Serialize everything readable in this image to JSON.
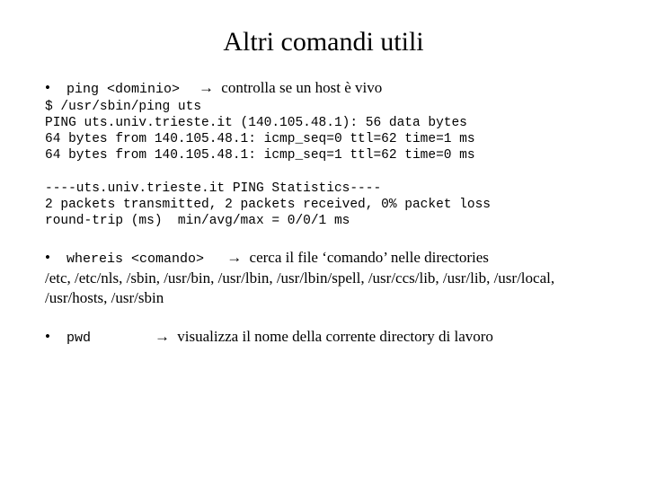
{
  "title": "Altri comandi utili",
  "items": [
    {
      "cmd": "ping <dominio>",
      "arrow": "→",
      "desc": "controlla se un host è vivo"
    },
    {
      "cmd": "whereis <comando>",
      "arrow": "→",
      "desc": "cerca il file ‘comando’ nelle directories"
    },
    {
      "cmd": "pwd",
      "arrow": "→",
      "desc": "visualizza il nome della corrente directory di lavoro"
    }
  ],
  "ping_output": "$ /usr/sbin/ping uts\nPING uts.univ.trieste.it (140.105.48.1): 56 data bytes\n64 bytes from 140.105.48.1: icmp_seq=0 ttl=62 time=1 ms\n64 bytes from 140.105.48.1: icmp_seq=1 ttl=62 time=0 ms\n\n----uts.univ.trieste.it PING Statistics----\n2 packets transmitted, 2 packets received, 0% packet loss\nround-trip (ms)  min/avg/max = 0/0/1 ms",
  "whereis_dirs": "/etc, /etc/nls, /sbin, /usr/bin, /usr/lbin,  /usr/lbin/spell, /usr/ccs/lib, /usr/lib, /usr/local, /usr/hosts, /usr/sbin"
}
